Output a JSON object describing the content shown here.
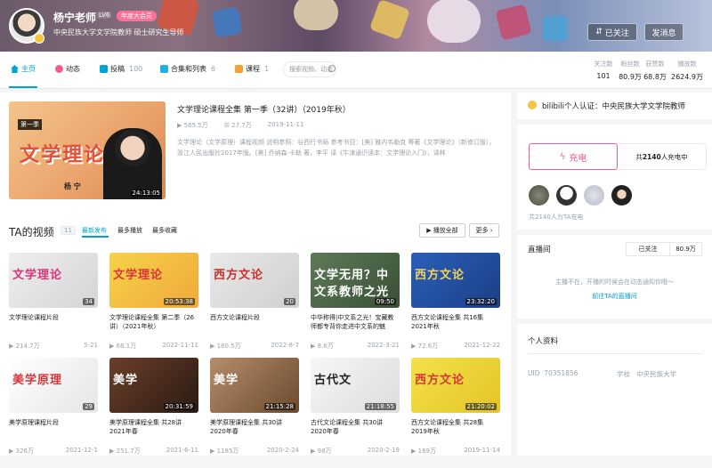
{
  "header": {
    "username": "杨宁老师",
    "level": "LV6",
    "vip_badge": "年度大会员",
    "signature": "中央民族大学文学院教师 硕士研究生导师",
    "follow_label": "已关注",
    "message_label": "发消息"
  },
  "nav": {
    "items": [
      {
        "label": "主页",
        "count": ""
      },
      {
        "label": "动态",
        "count": ""
      },
      {
        "label": "投稿",
        "count": "100"
      },
      {
        "label": "合集和列表",
        "count": "6"
      },
      {
        "label": "课程",
        "count": "1"
      }
    ],
    "search_placeholder": "搜索视频、动态",
    "stats": [
      {
        "label": "关注数",
        "value": "101"
      },
      {
        "label": "粉丝数",
        "value": "80.9万"
      },
      {
        "label": "获赞数",
        "value": "68.8万"
      },
      {
        "label": "播放数",
        "value": "2624.9万"
      }
    ]
  },
  "featured": {
    "tag": "第一季",
    "cover_text": "文学理论",
    "cover_name": "杨 宁",
    "duration": "24:13:05",
    "title": "文学理论课程全集 第一季（32讲）（2019年秋）",
    "plays": "565.5万",
    "danmaku": "27.7万",
    "date": "2019-11-11",
    "description": "文学理论（文学原理）课程视频 说明参照：谷西行书局 参考书目：[美] 雅内韦勒克 等著《文学理论》（新修订版），浙江人民出版社2017年版。[美] 乔纳森·卡勒 著，李平 译《牛津通识读本：文学理论入门》，译林"
  },
  "videos_section": {
    "title": "TA的视频",
    "count": "11",
    "sort_tabs": [
      "最新发布",
      "最多播放",
      "最多收藏"
    ],
    "play_all_label": "播放全部",
    "more_label": "更多"
  },
  "videos": [
    {
      "cover_text": "文学理论",
      "dur": "34",
      "title": "文学理论课程片段",
      "plays": "214.7万",
      "date": "5-21"
    },
    {
      "cover_text": "文学理论",
      "dur": "20:53:38",
      "title": "文学理论课程全集 第二季（26讲）（2021年秋）",
      "plays": "66.1万",
      "date": "2022-11-11"
    },
    {
      "cover_text": "西方文论",
      "dur": "20",
      "title": "西方文论课程片段",
      "plays": "160.5万",
      "date": "2022-8-7"
    },
    {
      "cover_text": "文学无用？中文系教师之光",
      "dur": "09:50",
      "title": "中华称得|中文系之光！宝藏教师都专背你走进中文系的魅",
      "plays": "8.6万",
      "date": "2022-3-21"
    },
    {
      "cover_text": "西方文论",
      "dur": "23:32:20",
      "title": "西方文论课程全集 共16集 2021年秋",
      "plays": "72.6万",
      "date": "2021-12-22"
    },
    {
      "cover_text": "美学原理",
      "dur": "29",
      "title": "美学原理课程片段",
      "plays": "326万",
      "date": "2021-12-1"
    },
    {
      "cover_text": "美学",
      "dur": "20:31:59",
      "title": "美学原理课程全集 共28讲 2021年春",
      "plays": "251.7万",
      "date": "2021-6-11"
    },
    {
      "cover_text": "美学",
      "dur": "21:15:28",
      "title": "美学原理课程全集 共30讲 2020年春",
      "plays": "1185万",
      "date": "2020-2-24"
    },
    {
      "cover_text": "古代文",
      "dur": "21:18:55",
      "title": "古代文论课程全集 共30讲 2020年春",
      "plays": "98万",
      "date": "2020-2-19"
    },
    {
      "cover_text": "西方文论",
      "dur": "21:20:02",
      "title": "西方文论课程全集 共28集 2019年秋",
      "plays": "169万",
      "date": "2019-11-14"
    }
  ],
  "sidebar": {
    "certification": "bilibili个人认证：中央民族大学文学院教师",
    "charge_label": "充电",
    "charge_count_pre": "共",
    "charge_count_num": "2140",
    "charge_count_post": "人充电中",
    "charge_summary": "共2140人为TA充电",
    "live": {
      "title": "直播间",
      "follow_label": "已关注",
      "fans": "80.9万",
      "message": "主播不在，开播的时候会在动态通知你哦～",
      "link": "前往TA的直播间"
    },
    "profile": {
      "title": "个人资料",
      "uid_label": "UID",
      "uid": "70351856",
      "school_label": "学校",
      "school": "中央民族大学"
    }
  },
  "colors": {
    "accent": "#00a1d6",
    "pink": "#fb7299",
    "charge": "#f25d8e"
  }
}
